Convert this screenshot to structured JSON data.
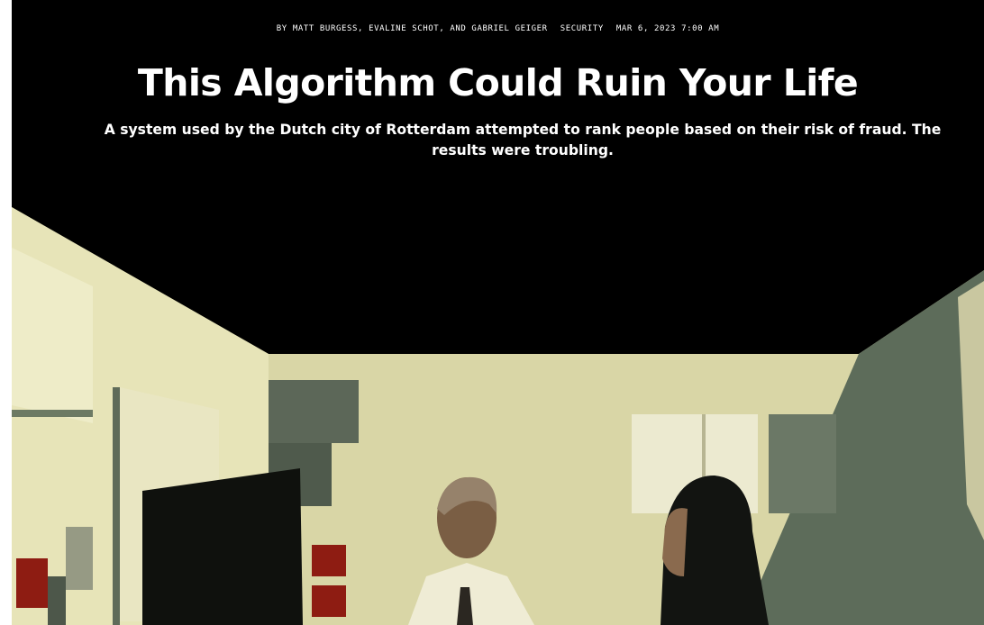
{
  "article": {
    "byline": "BY MATT BURGESS, EVALINE SCHOT, AND GABRIEL GEIGER",
    "rubric": "SECURITY",
    "published": "MAR 6, 2023 7:00 AM",
    "headline": "This Algorithm Could Ruin Your Life",
    "dek": "A system used by the Dutch city of Rotterdam attempted to rank people based on their risk of fraud. The results were troubling."
  },
  "colors": {
    "background": "#000000",
    "text": "#ffffff",
    "wall": "#d9d6a6",
    "shadow_wall": "#5d6c5a",
    "accent_red": "#8e1c12"
  }
}
